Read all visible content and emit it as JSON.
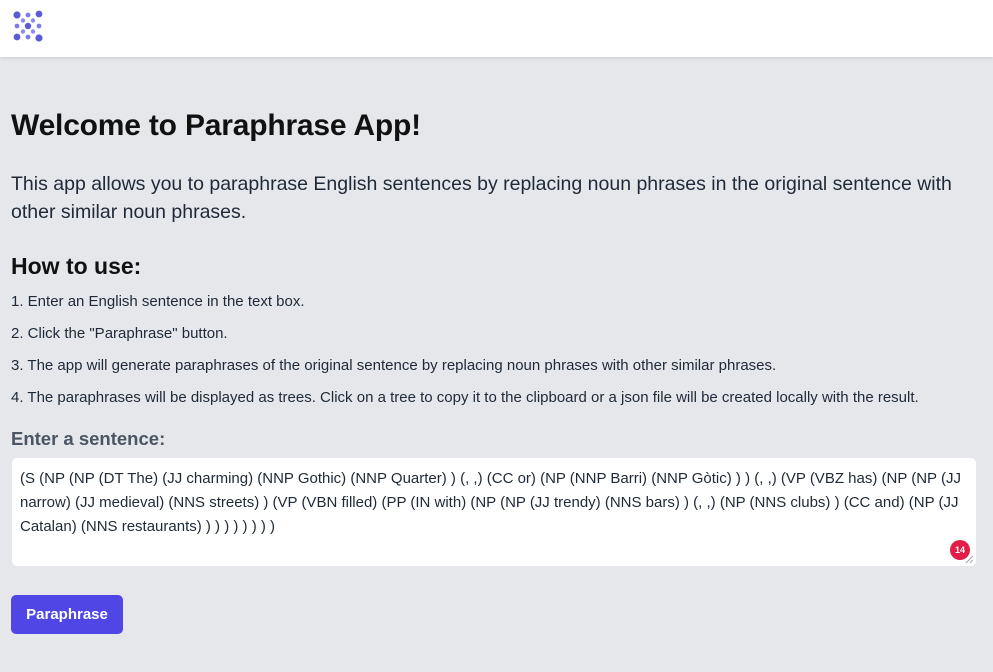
{
  "header": {
    "logo_icon": "dots-logo-icon",
    "brand_color": "#5b5bd6"
  },
  "main": {
    "title": "Welcome to Paraphrase App!",
    "intro": "This app allows you to paraphrase English sentences by replacing noun phrases in the original sentence with other similar noun phrases.",
    "howto_heading": "How to use:",
    "steps": [
      "1. Enter an English sentence in the text box.",
      "2. Click the \"Paraphrase\" button.",
      "3. The app will generate paraphrases of the original sentence by replacing noun phrases with other similar phrases.",
      "4. The paraphrases will be displayed as trees. Click on a tree to copy it to the clipboard or a json file will be created locally with the result."
    ],
    "input_label": "Enter a sentence:",
    "input_value": "(S (NP (NP (DT The) (JJ charming) (NNP Gothic) (NNP Quarter) ) (, ,) (CC or) (NP (NNP Barri) (NNP Gòtic) ) ) (, ,) (VP (VBZ has) (NP (NP (JJ narrow) (JJ medieval) (NNS streets) ) (VP (VBN filled) (PP (IN with) (NP (NP (JJ trendy) (NNS bars) ) (, ,) (NP (NNS clubs) ) (CC and) (NP (JJ Catalan) (NNS restaurants) ) ) ) ) ) ) ) )",
    "spellcheck_badge": "14",
    "badge_color": "#e11d48",
    "button_label": "Paraphrase",
    "button_color": "#4f46e5"
  }
}
